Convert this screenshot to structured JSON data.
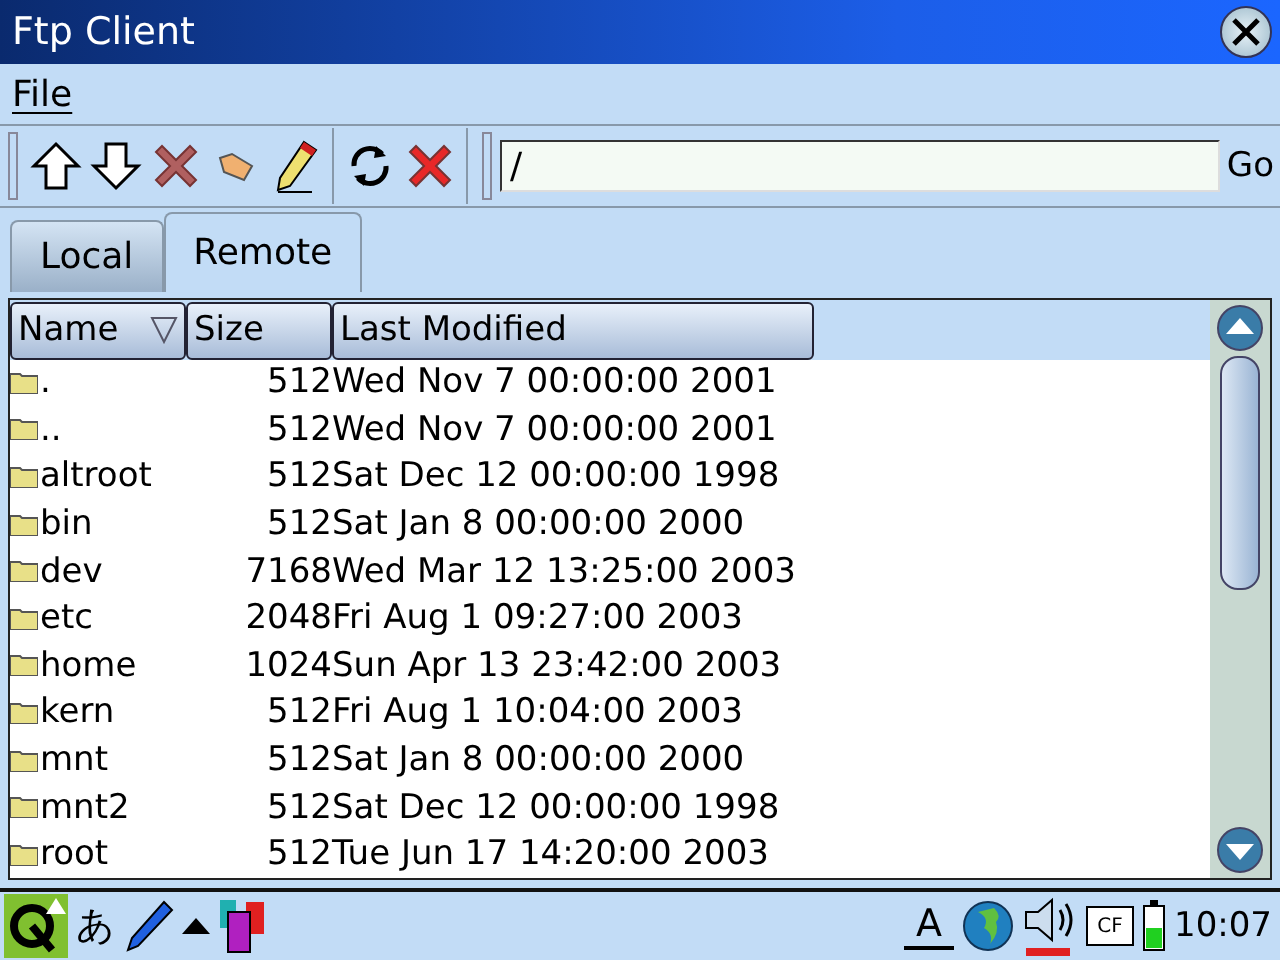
{
  "window": {
    "title": "Ftp Client"
  },
  "menu": [
    "File"
  ],
  "path": {
    "value": "/",
    "go": "Go"
  },
  "tabs": [
    {
      "label": "Local",
      "selected": false
    },
    {
      "label": "Remote",
      "selected": true
    }
  ],
  "table": {
    "columns": [
      {
        "label": "Name",
        "sorted": true
      },
      {
        "label": "Size",
        "sorted": false
      },
      {
        "label": "Last Modified",
        "sorted": false
      }
    ],
    "rows": [
      {
        "name": ".",
        "size": "512",
        "modified": "Wed Nov 7 00:00:00 2001"
      },
      {
        "name": "..",
        "size": "512",
        "modified": "Wed Nov 7 00:00:00 2001"
      },
      {
        "name": "altroot",
        "size": "512",
        "modified": "Sat Dec 12 00:00:00 1998"
      },
      {
        "name": "bin",
        "size": "512",
        "modified": "Sat Jan 8 00:00:00 2000"
      },
      {
        "name": "dev",
        "size": "7168",
        "modified": "Wed Mar 12 13:25:00 2003"
      },
      {
        "name": "etc",
        "size": "2048",
        "modified": "Fri Aug 1 09:27:00 2003"
      },
      {
        "name": "home",
        "size": "1024",
        "modified": "Sun Apr 13 23:42:00 2003"
      },
      {
        "name": "kern",
        "size": "512",
        "modified": "Fri Aug 1 10:04:00 2003"
      },
      {
        "name": "mnt",
        "size": "512",
        "modified": "Sat Jan 8 00:00:00 2000"
      },
      {
        "name": "mnt2",
        "size": "512",
        "modified": "Sat Dec 12 00:00:00 1998"
      },
      {
        "name": "root",
        "size": "512",
        "modified": "Tue Jun 17 14:20:00 2003"
      }
    ]
  },
  "taskbar": {
    "input_method": "あ",
    "keyboard": "A",
    "card": "CF",
    "clock": "10:07"
  }
}
